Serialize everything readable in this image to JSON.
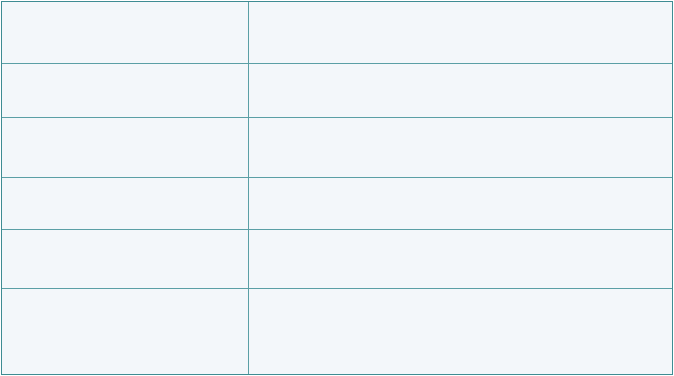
{
  "table": {
    "rows": [
      {
        "label": "",
        "value": ""
      },
      {
        "label": "",
        "value": ""
      },
      {
        "label": "",
        "value": ""
      },
      {
        "label": "",
        "value": ""
      },
      {
        "label": "",
        "value": ""
      },
      {
        "label": "",
        "value": ""
      }
    ]
  },
  "colors": {
    "border": "#3e8c93",
    "grid": "#5a9fa5",
    "cell_background": "#f3f7fa"
  }
}
